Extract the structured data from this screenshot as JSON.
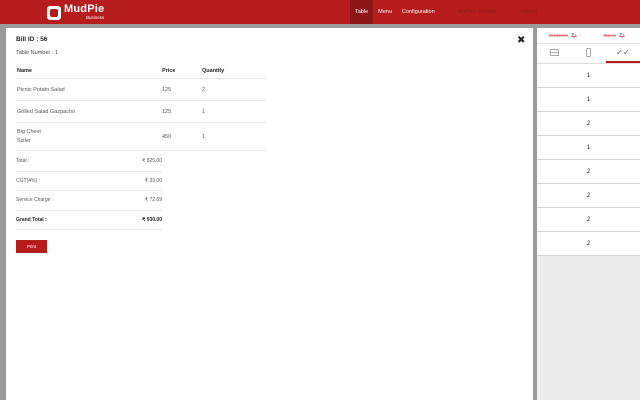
{
  "header": {
    "logo_main": "MudPie",
    "logo_sub": "Business",
    "nav": [
      "Table",
      "Menu",
      "Configuration",
      "Kitchen Display",
      "Logout"
    ]
  },
  "bill": {
    "bill_id": "Bill ID : 56",
    "table_number": "Table Number : 1",
    "columns": {
      "name": "Name",
      "price": "Price",
      "quantity": "Quantity"
    },
    "items": [
      {
        "name": "Picnic Potato Salad",
        "sub": "",
        "price": "125",
        "qty": "2"
      },
      {
        "name": "Grilled Salad Gazpacho",
        "sub": "",
        "price": "125",
        "qty": "1"
      },
      {
        "name": "Big Chest",
        "sub": "Sizler",
        "price": "450",
        "qty": "1"
      }
    ],
    "totals": [
      {
        "label": "Total :",
        "value": "₹ 825.00"
      },
      {
        "label": "CGT(4%) :",
        "value": "₹ 33.00"
      },
      {
        "label": "Service Charge :",
        "value": "₹ 72.69"
      },
      {
        "label": "Grand Total :",
        "value": "₹ 930.00"
      }
    ],
    "print_label": "Print"
  },
  "side": {
    "tabs": [
      "ORDERS",
      "BILLS"
    ],
    "icons": [
      "card-icon",
      "phone-icon",
      "double-check-icon"
    ],
    "list": [
      "1",
      "1",
      "2",
      "1",
      "2",
      "2",
      "2",
      "2"
    ]
  },
  "colors": {
    "brand": "#b71c1c",
    "brand_dark": "#8e1515"
  }
}
